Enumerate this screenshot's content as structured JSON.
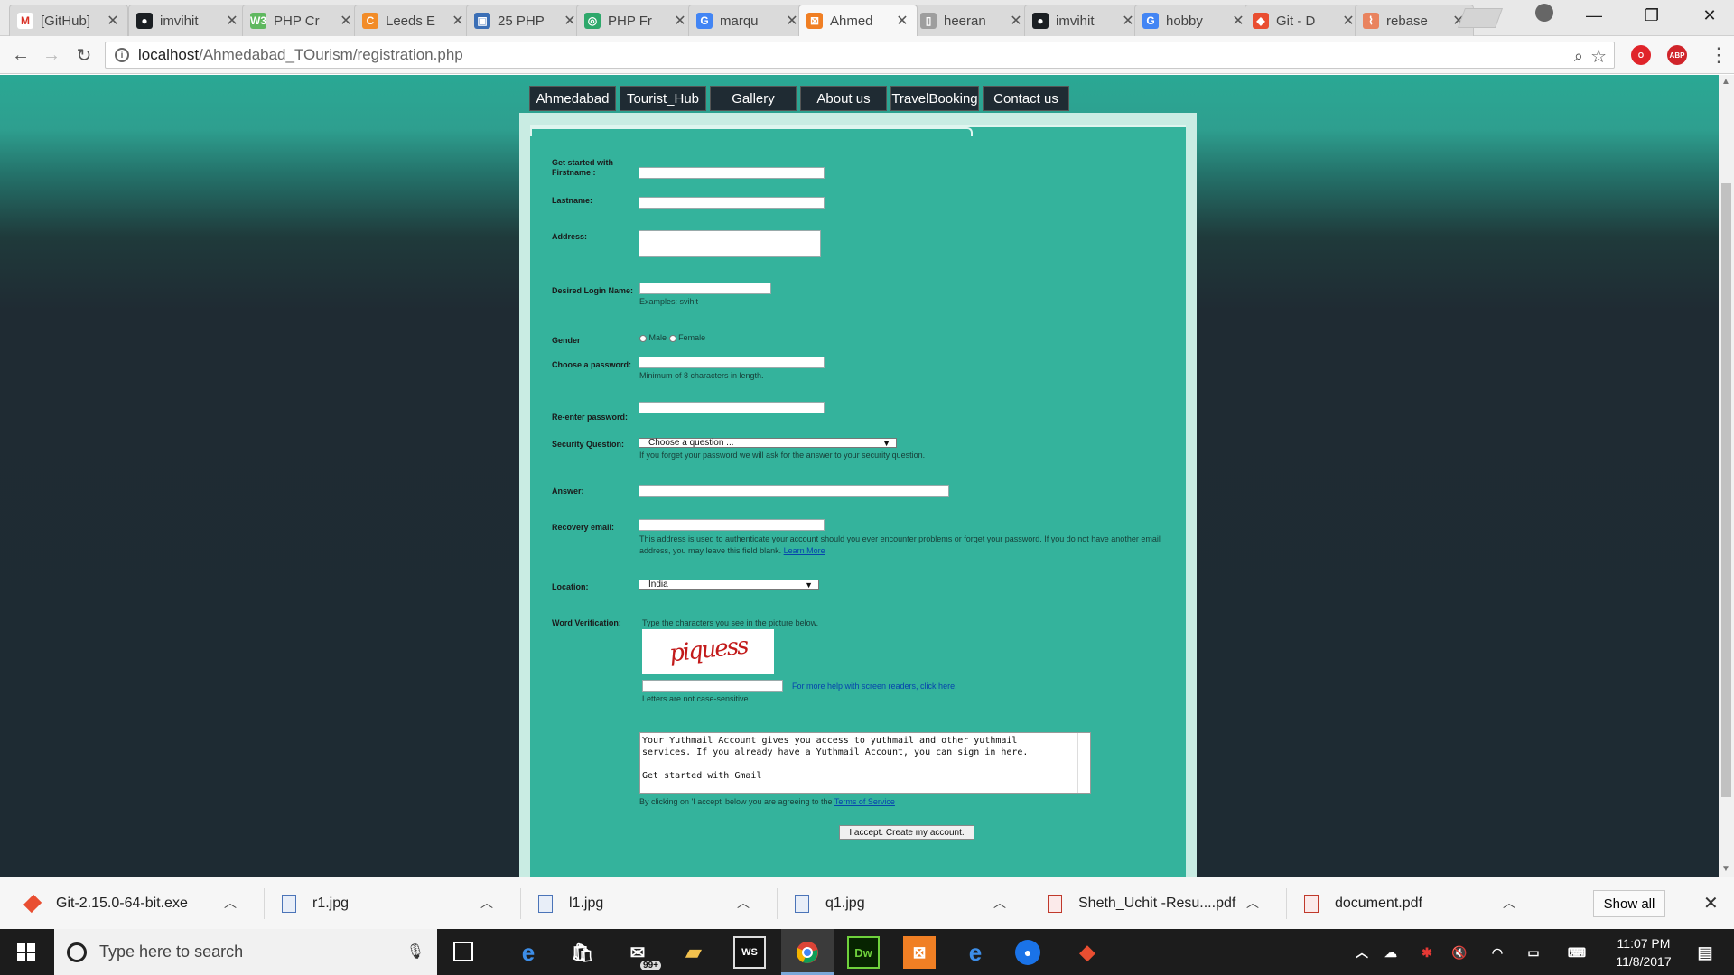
{
  "browser": {
    "tabs": [
      {
        "label": "[GitHub]",
        "fav_color": "#ffffff",
        "fav_glyph": "M",
        "icon": "gmail-icon"
      },
      {
        "label": "imvihit",
        "fav_color": "#1b1f23",
        "fav_glyph": "●",
        "icon": "github-icon"
      },
      {
        "label": "PHP Cr",
        "fav_color": "#5fb85f",
        "fav_glyph": "W3",
        "icon": "w3schools-icon"
      },
      {
        "label": "Leeds E",
        "fav_color": "#f28c28",
        "fav_glyph": "C",
        "icon": "leeds-icon"
      },
      {
        "label": "25 PHP",
        "fav_color": "#3b6fb6",
        "fav_glyph": "▣",
        "icon": "site-icon"
      },
      {
        "label": "PHP Fr",
        "fav_color": "#2ea86b",
        "fav_glyph": "◎",
        "icon": "site-icon"
      },
      {
        "label": "marqu",
        "fav_color": "#4285f4",
        "fav_glyph": "G",
        "icon": "google-icon"
      },
      {
        "label": "Ahmed",
        "fav_color": "#f07f24",
        "fav_glyph": "⊠",
        "icon": "xampp-icon"
      },
      {
        "label": "heeran",
        "fav_color": "#9e9e9e",
        "fav_glyph": "▯",
        "icon": "document-icon"
      },
      {
        "label": "imvihit",
        "fav_color": "#1b1f23",
        "fav_glyph": "●",
        "icon": "github-icon"
      },
      {
        "label": "hobby",
        "fav_color": "#4285f4",
        "fav_glyph": "G",
        "icon": "google-icon"
      },
      {
        "label": "Git - D",
        "fav_color": "#e94e31",
        "fav_glyph": "◆",
        "icon": "git-icon"
      },
      {
        "label": "rebase",
        "fav_color": "#e9835e",
        "fav_glyph": "⌇",
        "icon": "site-icon"
      }
    ],
    "active_tab": 7,
    "url_host": "localhost",
    "url_path": "/Ahmedabad_TOurism/registration.php",
    "extensions": [
      {
        "name": "opera-extension-icon",
        "color": "#e0242a",
        "glyph": "O"
      },
      {
        "name": "adblock-icon",
        "color": "#d0242a",
        "glyph": "ABP"
      }
    ]
  },
  "site": {
    "nav": [
      "Ahmedabad",
      "Tourist_Hub",
      "Gallery",
      "About us",
      "TravelBooking",
      "Contact us"
    ],
    "form": {
      "firstname_label": "Get started with Firstname :",
      "lastname_label": "Lastname:",
      "address_label": "Address:",
      "login_label": "Desired Login Name:",
      "login_hint": "Examples: svihit",
      "gender_label": "Gender",
      "gender_male": "Male",
      "gender_female": "Female",
      "password_label": "Choose a password:",
      "password_hint": "Minimum of 8 characters in length.",
      "reenter_label": "Re-enter password:",
      "security_label": "Security Question:",
      "security_value": "Choose a question ...",
      "security_hint": "If you forget your password we will ask for the answer to your security question.",
      "answer_label": "Answer:",
      "recovery_label": "Recovery email:",
      "recovery_hint": "This address is used to authenticate your account should you ever encounter problems or forget your password. If you do not have another email address, you may leave this field blank.",
      "recovery_link": "Learn More",
      "location_label": "Location:",
      "location_value": "India",
      "word_label": "Word Verification:",
      "word_hint": "Type the characters you see in the picture below.",
      "captcha_text": "piquess",
      "screenreader_hint": "For more help with screen readers, click here.",
      "case_hint": "Letters are not case-sensitive",
      "tos_text": "Your Yuthmail Account gives you access to yuthmail and other yuthmail\nservices. If you already have a Yuthmail Account, you can sign in here.\n\nGet started with Gmail",
      "agree_prefix": "By clicking on 'I accept' below you are agreeing to the",
      "agree_link": "Terms of Service",
      "accept_button": "I accept. Create my account."
    }
  },
  "downloads": {
    "items": [
      "Git-2.15.0-64-bit.exe",
      "r1.jpg",
      "l1.jpg",
      "q1.jpg",
      "Sheth_Uchit -Resu....pdf",
      "document.pdf"
    ],
    "show_all": "Show all"
  },
  "taskbar": {
    "search_placeholder": "Type here to search",
    "mail_badge": "99+",
    "time": "11:07 PM",
    "date": "11/8/2017"
  }
}
